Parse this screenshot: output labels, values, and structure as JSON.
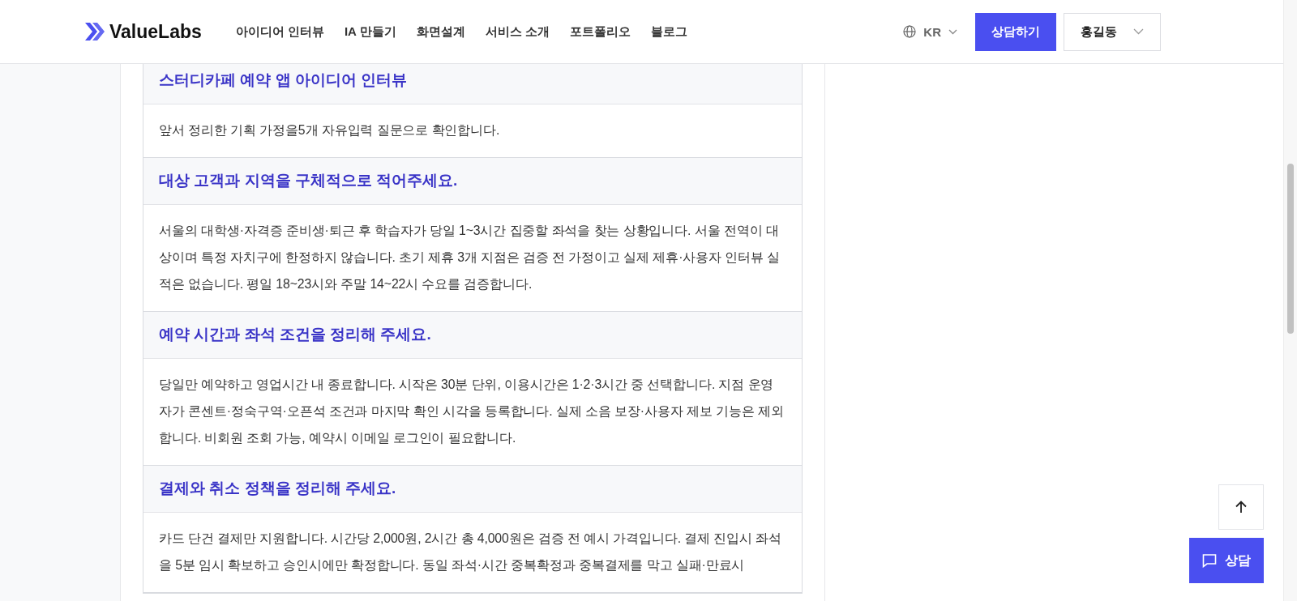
{
  "header": {
    "logo": "ValueLabs",
    "nav": [
      {
        "label": "아이디어 인터뷰"
      },
      {
        "label": "IA 만들기"
      },
      {
        "label": "화면설계"
      },
      {
        "label": "서비스 소개"
      },
      {
        "label": "포트폴리오"
      },
      {
        "label": "블로그"
      }
    ],
    "language": "KR",
    "consult_button": "상담하기",
    "user_menu": "홍길동"
  },
  "sections": [
    {
      "title": "스터디카페 예약 앱 아이디어 인터뷰",
      "text": "앞서 정리한 기획 가정을5개 자유입력 질문으로 확인합니다."
    },
    {
      "title": "대상 고객과 지역을 구체적으로 적어주세요.",
      "text": "서울의 대학생·자격증 준비생·퇴근 후 학습자가 당일 1~3시간 집중할 좌석을 찾는 상황입니다. 서울 전역이 대상이며 특정 자치구에 한정하지 않습니다. 초기 제휴 3개 지점은 검증 전 가정이고 실제 제휴·사용자 인터뷰 실적은 없습니다. 평일 18~23시와 주말 14~22시 수요를 검증합니다."
    },
    {
      "title": "예약 시간과 좌석 조건을 정리해 주세요.",
      "text": "당일만 예약하고 영업시간 내 종료합니다. 시작은 30분 단위, 이용시간은 1·2·3시간 중 선택합니다. 지점 운영자가 콘센트·정숙구역·오픈석 조건과 마지막 확인 시각을 등록합니다. 실제 소음 보장·사용자 제보 기능은 제외합니다. 비회원 조회 가능, 예약시 이메일 로그인이 필요합니다."
    },
    {
      "title": "결제와 취소 정책을 정리해 주세요.",
      "text": "카드 단건 결제만 지원합니다. 시간당 2,000원, 2시간 총 4,000원은 검증 전 예시 가격입니다. 결제 진입시 좌석을 5분 임시 확보하고 승인시에만 확정합니다. 동일 좌석·시간 중복확정과 중복결제를 막고 실패·만료시"
    }
  ],
  "floating": {
    "chat_button": "상담"
  }
}
